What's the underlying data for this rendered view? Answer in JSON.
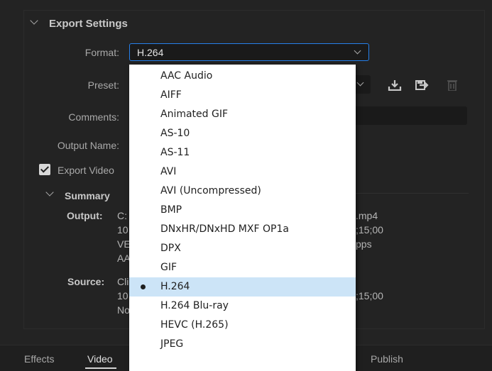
{
  "export_settings": {
    "title": "Export Settings",
    "format_label": "Format:",
    "format_value": "H.264",
    "preset_label": "Preset:",
    "comments_label": "Comments:",
    "output_name_label": "Output Name:",
    "export_video_label": "Export Video"
  },
  "summary": {
    "title": "Summary",
    "output_label": "Output:",
    "output_lines": [
      "C:",
      "10",
      "VE",
      "AA"
    ],
    "output_right": [
      ".mp4",
      ";15;00",
      "pps"
    ],
    "source_label": "Source:",
    "source_lines": [
      "Cli",
      "10",
      "No"
    ],
    "source_right": [
      ";15;00"
    ]
  },
  "format_options": [
    "AAC Audio",
    "AIFF",
    "Animated GIF",
    "AS-10",
    "AS-11",
    "AVI",
    "AVI (Uncompressed)",
    "BMP",
    "DNxHR/DNxHD MXF OP1a",
    "DPX",
    "GIF",
    "H.264",
    "H.264 Blu-ray",
    "HEVC (H.265)",
    "JPEG"
  ],
  "selected_format_index": 11,
  "tabs": {
    "effects": "Effects",
    "video": "Video",
    "publish": "Publish"
  },
  "icons": [
    "chevron-down-icon",
    "import-preset-icon",
    "save-preset-icon",
    "delete-preset-icon",
    "checkmark-icon"
  ]
}
